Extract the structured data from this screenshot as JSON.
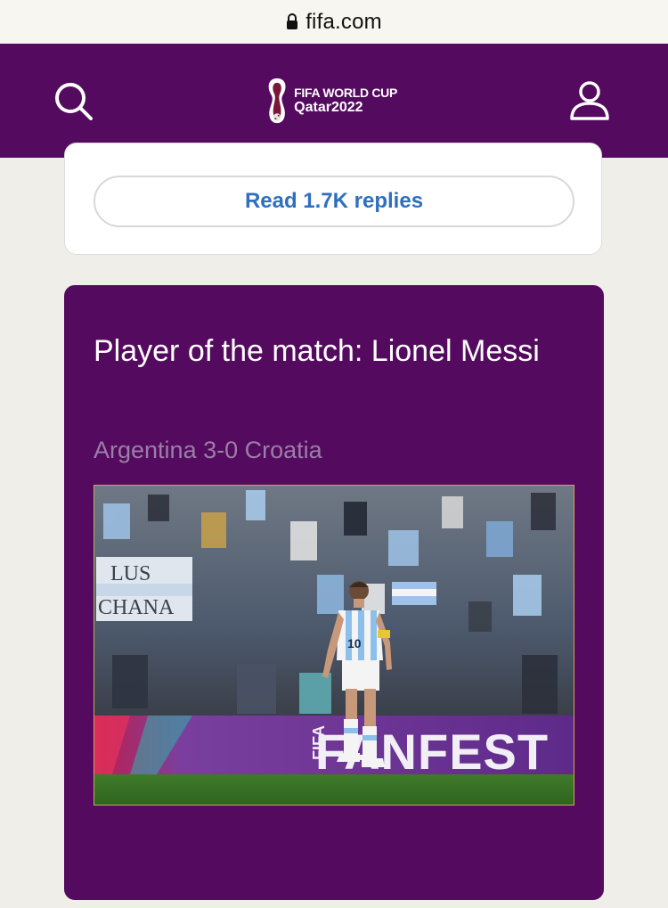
{
  "browser": {
    "url": "fifa.com",
    "lock_icon": "lock-icon"
  },
  "header": {
    "logo_line1": "FIFA WORLD CUP",
    "logo_line2": "Qatar2022",
    "search_icon": "search-icon",
    "user_icon": "user-icon",
    "bg_color": "#540a5e"
  },
  "replies": {
    "button_label": "Read 1.7K replies",
    "color": "#2f6fbd"
  },
  "player_card": {
    "title": "Player of the match: Lionel Messi",
    "subtitle": "Argentina 3-0 Croatia",
    "photo": {
      "banner_left_line1": "LUS",
      "banner_left_line2": "CHANA",
      "board_text": "FANFEST",
      "board_side_text": "FIFA",
      "shirt_number": "10"
    }
  }
}
